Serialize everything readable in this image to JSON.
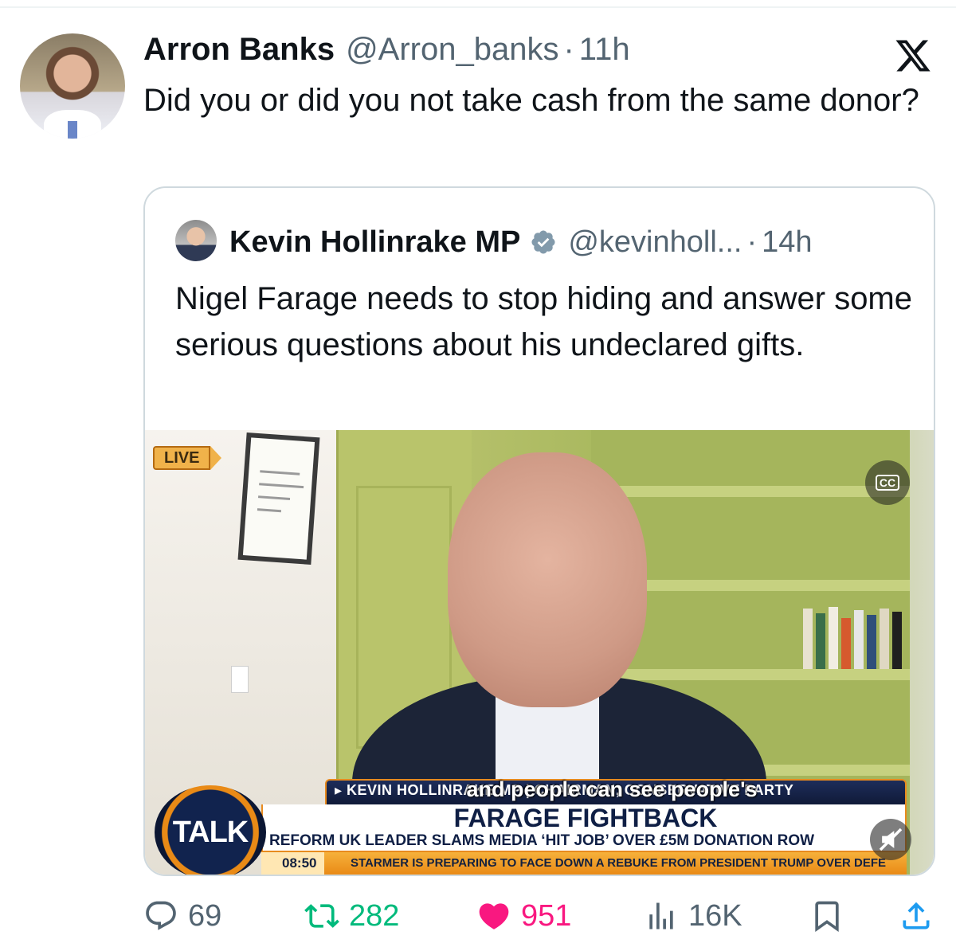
{
  "tweet": {
    "author_name": "Arron Banks",
    "handle": "@Arron_banks",
    "separator": "·",
    "time": "11h",
    "text": "Did you or did you not take cash from the same donor?"
  },
  "platform": {
    "logo_icon": "x-logo-icon"
  },
  "quoted": {
    "author_name": "Kevin Hollinrake MP",
    "verified": true,
    "handle": "@kevinholl...",
    "separator": "·",
    "time": "14h",
    "text": "Nigel Farage needs to stop hiding and answer some serious questions about his undeclared gifts.",
    "video": {
      "live_label": "LIVE",
      "cc_label": "CC",
      "strap_title": "▸ KEVIN HOLLINRAKE MP | CHAIRMAN, CONSERVATIVE PARTY",
      "caption": "and people can see people's",
      "headline": "FARAGE FIGHTBACK",
      "subhead": "REFORM UK LEADER SLAMS MEDIA ‘HIT JOB’ OVER £5M DONATION ROW",
      "ticker_time": "08:50",
      "ticker_text": "STARMER IS PREPARING TO FACE DOWN A REBUKE FROM PRESIDENT TRUMP OVER DEFE",
      "channel_logo": "TALK"
    }
  },
  "actions": {
    "replies": "69",
    "retweets": "282",
    "likes": "951",
    "views": "16K"
  },
  "colors": {
    "text": "#0f1419",
    "secondary": "#536471",
    "retweet": "#00ba7c",
    "like": "#f91880",
    "share": "#1d9bf0",
    "verified": "#829aab",
    "border": "#cfd9de"
  }
}
